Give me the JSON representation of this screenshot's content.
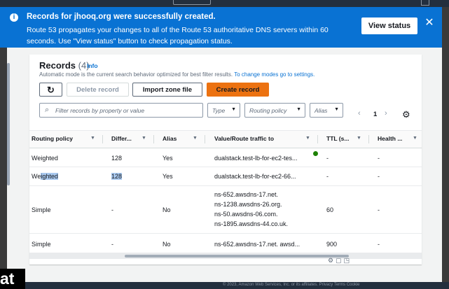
{
  "banner": {
    "title": "Records for jhooq.org were successfully created.",
    "body": "Route 53 propagates your changes to all of the Route 53 authoritative DNS servers within 60 seconds. Use \"View status\" button to check propagation status.",
    "view_status_label": "View status",
    "close_label": "✕",
    "status_color": "#0972d3"
  },
  "records": {
    "title": "Records",
    "count": "(4)",
    "info_label": "Info",
    "description": "Automatic mode is the current search behavior optimized for best filter results.",
    "description_link": "To change modes go to settings.",
    "refresh_icon": "refresh-icon",
    "delete_label": "Delete record",
    "import_label": "Import zone file",
    "create_label": "Create record",
    "search_placeholder": "Filter records by property or value",
    "filters": {
      "type": "Type",
      "routing": "Routing policy",
      "alias": "Alias"
    },
    "pagination": {
      "prev": "‹",
      "page": "1",
      "next": "›"
    },
    "accent_color": "#ec7211"
  },
  "table": {
    "columns": [
      "Routing policy",
      "Differ...",
      "Alias",
      "Value/Route traffic to",
      "TTL (s...",
      "Health ..."
    ],
    "rows": [
      {
        "routing": "Weighted",
        "diff": "128",
        "alias": "Yes",
        "value": [
          "dualstack.test-lb-for-ec2-tes..."
        ],
        "ttl": "-",
        "health": "-"
      },
      {
        "routing_pre": "We",
        "routing_hl": "ighted",
        "diff": "128",
        "alias": "Yes",
        "value": [
          "dualstack.test-lb-for-ec2-66..."
        ],
        "ttl": "-",
        "health": "-"
      },
      {
        "routing": "Simple",
        "diff": "-",
        "alias": "No",
        "value": [
          "ns-652.awsdns-17.net.",
          "ns-1238.awsdns-26.org.",
          "ns-50.awsdns-06.com.",
          "ns-1895.awsdns-44.co.uk."
        ],
        "ttl": "60",
        "health": "-"
      },
      {
        "routing": "Simple",
        "diff": "-",
        "alias": "No",
        "value": [
          "ns-652.awsdns-17.net. awsd..."
        ],
        "ttl": "900",
        "health": "-"
      }
    ]
  },
  "footer": {
    "text": "© 2023, Amazon Web Services, Inc. or its affiliates.   Privacy   Terms   Cookie"
  },
  "overlay": {
    "corner_text": "at"
  }
}
